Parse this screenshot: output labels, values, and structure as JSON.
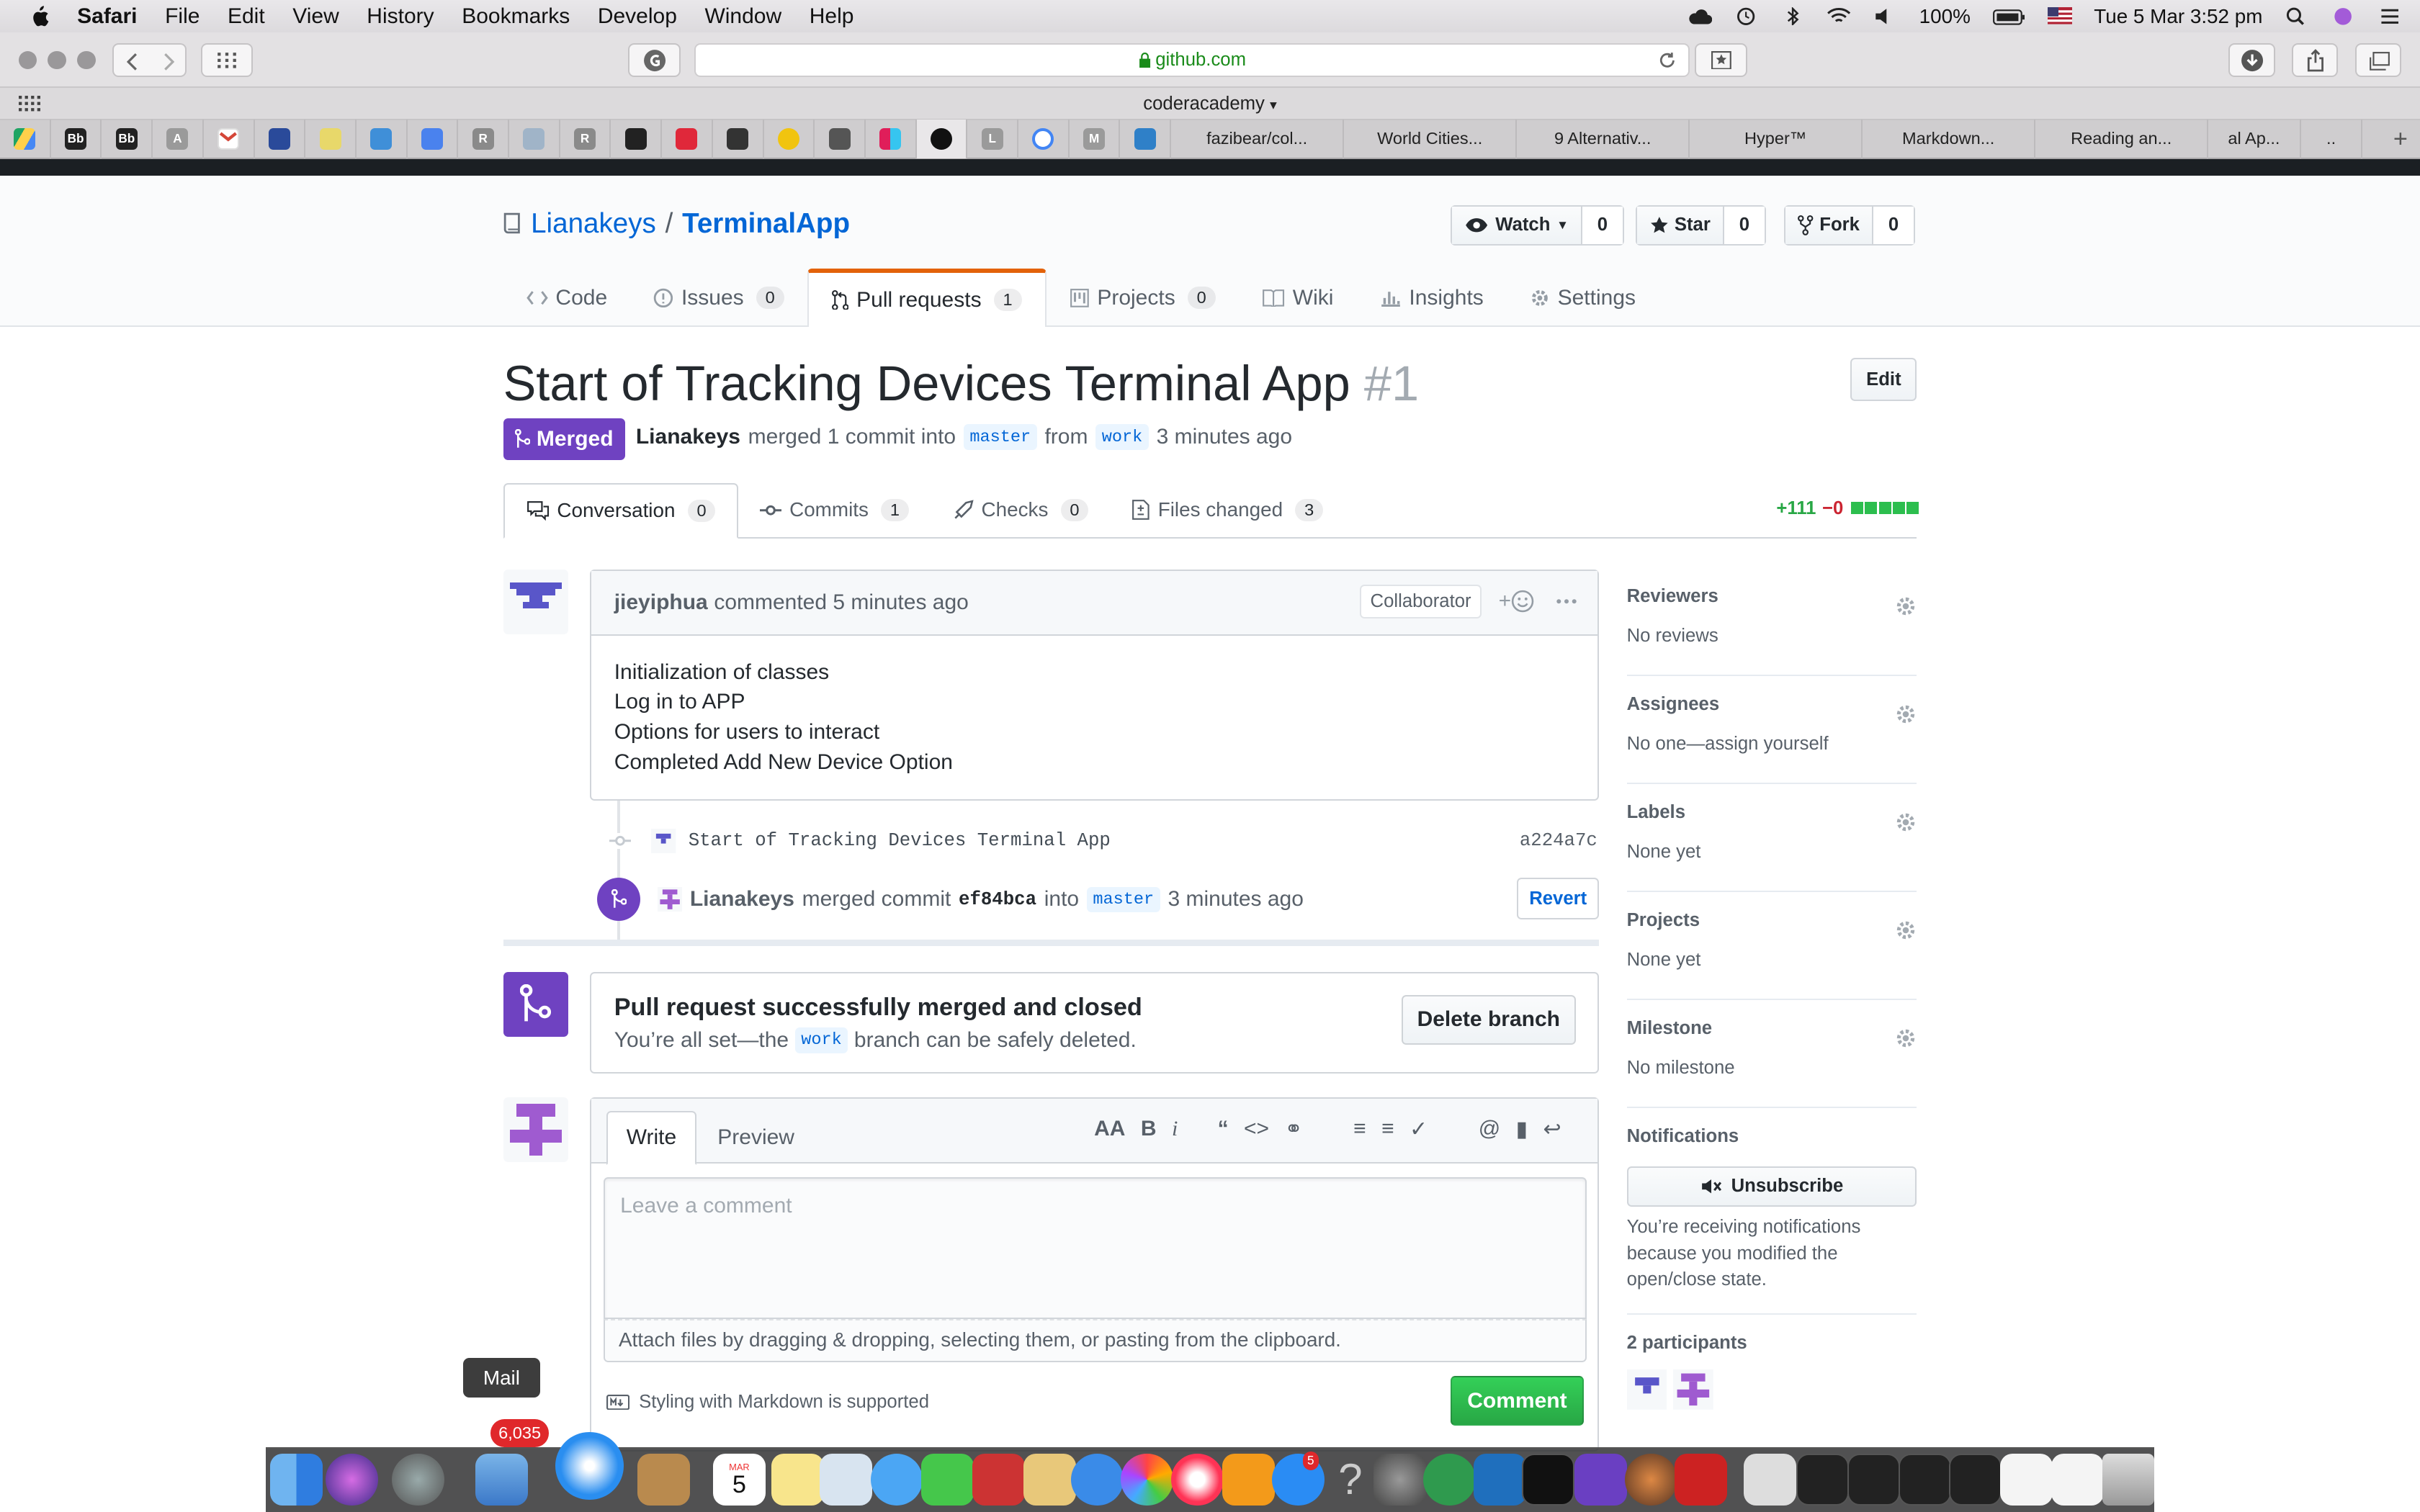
{
  "menubar": {
    "app": "Safari",
    "items": [
      "File",
      "Edit",
      "View",
      "History",
      "Bookmarks",
      "Develop",
      "Window",
      "Help"
    ],
    "battery": "100%",
    "clock": "Tue 5 Mar  3:52 pm"
  },
  "browser": {
    "url": "github.com",
    "favorites_label": "coderacademy",
    "tab_icons": [
      "Bb",
      "Bb",
      "A",
      "R",
      "R",
      "L",
      "M"
    ],
    "tab_titles": [
      "fazibear/col...",
      "World Cities...",
      "9 Alternativ...",
      "Hyper™",
      "Markdown...",
      "Reading an...",
      "al Ap..."
    ]
  },
  "repo": {
    "owner": "Lianakeys",
    "separator": "/",
    "name": "TerminalApp",
    "watch_label": "Watch",
    "watch_count": "0",
    "star_label": "Star",
    "star_count": "0",
    "fork_label": "Fork",
    "fork_count": "0",
    "nav": [
      {
        "label": "Code",
        "count": ""
      },
      {
        "label": "Issues",
        "count": "0"
      },
      {
        "label": "Pull requests",
        "count": "1"
      },
      {
        "label": "Projects",
        "count": "0"
      },
      {
        "label": "Wiki",
        "count": ""
      },
      {
        "label": "Insights",
        "count": ""
      },
      {
        "label": "Settings",
        "count": ""
      }
    ]
  },
  "pr": {
    "title": "Start of Tracking Devices Terminal App",
    "number": "#1",
    "edit_label": "Edit",
    "state": "Merged",
    "author": "Lianakeys",
    "meta_merged": "merged 1 commit into",
    "base": "master",
    "meta_from": "from",
    "head": "work",
    "time": "3 minutes ago",
    "tabs": [
      {
        "label": "Conversation",
        "count": "0"
      },
      {
        "label": "Commits",
        "count": "1"
      },
      {
        "label": "Checks",
        "count": "0"
      },
      {
        "label": "Files changed",
        "count": "3"
      }
    ],
    "additions": "+111",
    "deletions": "−0"
  },
  "comment": {
    "author": "jieyiphua",
    "action": "commented 5 minutes ago",
    "role": "Collaborator",
    "reaction_plus": "+",
    "lines": [
      "Initialization of classes",
      "Log in to APP",
      "Options for users to interact",
      "Completed Add New Device Option"
    ]
  },
  "commit": {
    "message": "Start of Tracking Devices Terminal App",
    "sha": "a224a7c"
  },
  "merge_event": {
    "user": "Lianakeys",
    "text1": "merged commit",
    "sha": "ef84bca",
    "text2": "into",
    "branch": "master",
    "time": "3 minutes ago",
    "revert_label": "Revert"
  },
  "merged_box": {
    "title": "Pull request successfully merged and closed",
    "text_before": "You’re all set—the",
    "branch": "work",
    "text_after": "branch can be safely deleted.",
    "delete_label": "Delete branch"
  },
  "editor": {
    "write_tab": "Write",
    "preview_tab": "Preview",
    "placeholder": "Leave a comment",
    "attach_hint": "Attach files by dragging & dropping, selecting them, or pasting from the clipboard.",
    "markdown_note": "Styling with Markdown is supported",
    "submit_label": "Comment"
  },
  "sidebar": {
    "reviewers_label": "Reviewers",
    "reviewers_value": "No reviews",
    "assignees_label": "Assignees",
    "assignees_value": "No one—assign yourself",
    "labels_label": "Labels",
    "labels_value": "None yet",
    "projects_label": "Projects",
    "projects_value": "None yet",
    "milestone_label": "Milestone",
    "milestone_value": "No milestone",
    "notifications_label": "Notifications",
    "unsubscribe_label": "Unsubscribe",
    "notifications_reason": "You’re receiving notifications because you modified the open/close state.",
    "participants_label": "2 participants"
  },
  "dock": {
    "tooltip": "Mail",
    "mail_badge": "6,035",
    "calendar_month": "MAR",
    "calendar_day": "5",
    "appstore_badge": "5"
  },
  "colors": {
    "merged_purple": "#6f42c1",
    "link_blue": "#0366d6",
    "success_green": "#28a745",
    "danger_red": "#cb2431",
    "nav_accent": "#e36209"
  }
}
